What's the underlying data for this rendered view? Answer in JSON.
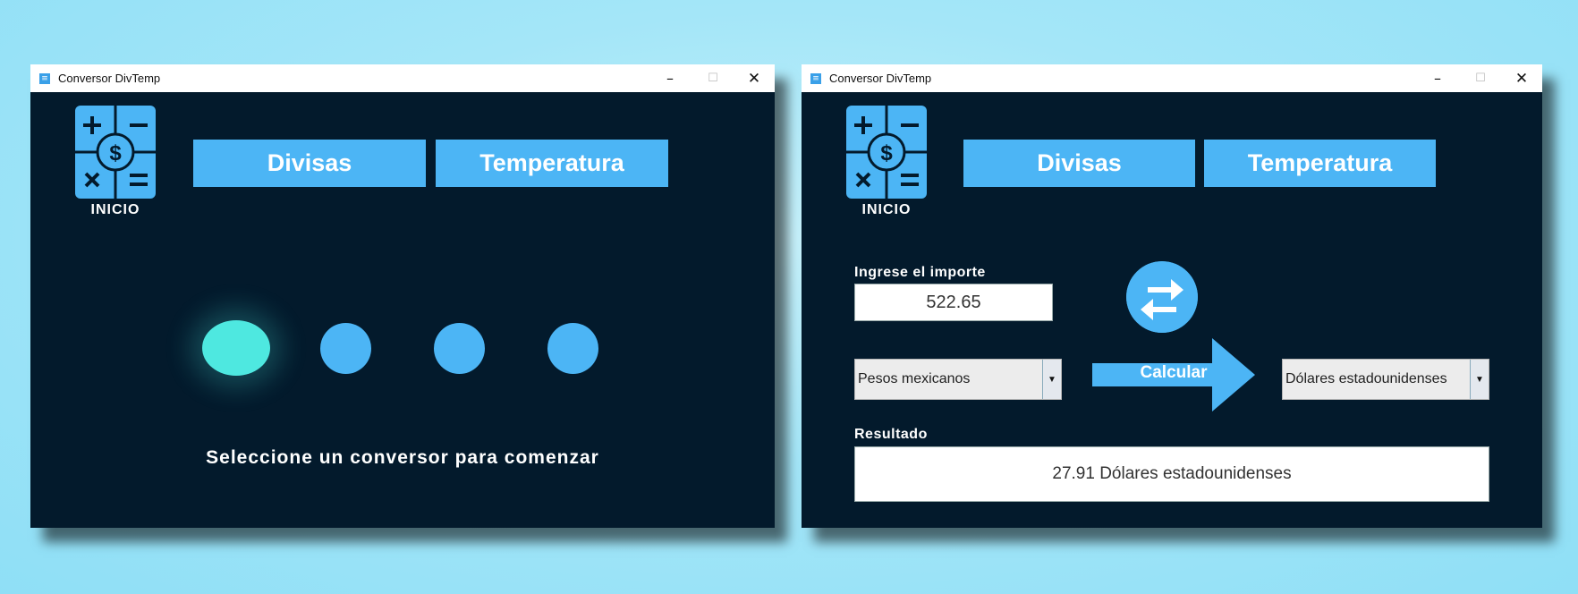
{
  "window_title": "Conversor DivTemp",
  "window_controls": {
    "minimize": "–",
    "maximize": "☐",
    "close": "✕"
  },
  "logo_caption": "INICIO",
  "nav": {
    "divisas": "Divisas",
    "temperatura": "Temperatura"
  },
  "home": {
    "hint": "Seleccione un conversor para comenzar",
    "dots_total": 4,
    "dots_active": 1
  },
  "converter": {
    "amount_label": "Ingrese el importe",
    "amount_value": "522.65",
    "from_currency": "Pesos mexicanos",
    "to_currency": "Dólares estadounidenses",
    "calculate_label": "Calcular",
    "result_label": "Resultado",
    "result_value": "27.91 Dólares estadounidenses"
  },
  "colors": {
    "background": "#a4e6f8",
    "window_bg": "#031a2c",
    "accent": "#4cb5f5",
    "active_dot": "#4ee8e0"
  },
  "icons": [
    "app-icon",
    "calculator-dollar-icon",
    "swap-arrows-icon",
    "arrow-right-icon",
    "dropdown-arrow-icon"
  ]
}
